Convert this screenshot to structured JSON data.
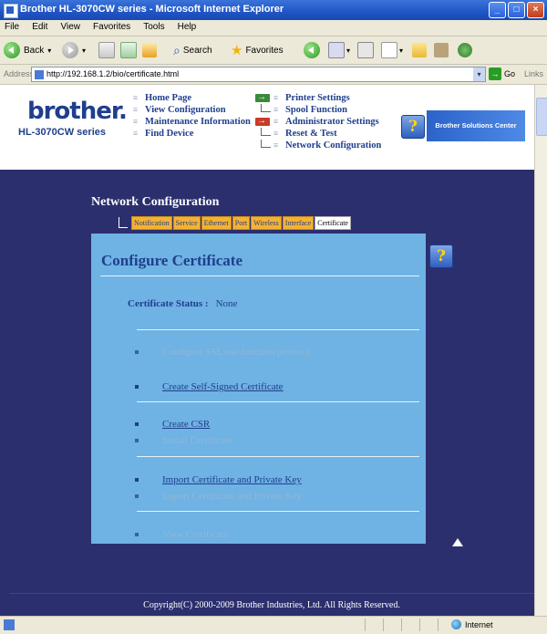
{
  "window": {
    "title": "Brother HL-3070CW series - Microsoft Internet Explorer",
    "buttons": [
      "_",
      "□",
      "×"
    ]
  },
  "menu": [
    "File",
    "Edit",
    "View",
    "Favorites",
    "Tools",
    "Help"
  ],
  "toolbar": {
    "back": "Back",
    "search": "Search",
    "favorites": "Favorites"
  },
  "address": {
    "label": "Address",
    "url": "http://192.168.1.2/bio/certificate.html",
    "go": "Go",
    "links": "Links"
  },
  "header": {
    "logo": "brother.",
    "model": "HL-3070CW series",
    "nav_left": [
      "Home Page",
      "View Configuration",
      "Maintenance Information",
      "Find Device"
    ],
    "nav_right": [
      "Printer Settings",
      "Spool Function",
      "Administrator Settings",
      "Reset & Test",
      "Network Configuration"
    ],
    "solutions": "Brother Solutions Center"
  },
  "section": {
    "title": "Network Configuration",
    "tabs": [
      "Notification",
      "Service",
      "Ethernet",
      "Port",
      "Wireless",
      "Interface",
      "Certificate"
    ],
    "active_tab": "Certificate"
  },
  "panel": {
    "title": "Configure Certificate",
    "status_label": "Certificate Status :",
    "status_value": "None",
    "items": [
      {
        "label": "Configure SSL use function/protocol",
        "enabled": false
      },
      {
        "label": "Create Self-Signed Certificate",
        "enabled": true
      },
      {
        "label": "Create CSR",
        "enabled": true
      },
      {
        "label": "Install Certificate",
        "enabled": false
      },
      {
        "label": "Import Certificate and Private Key",
        "enabled": true
      },
      {
        "label": "Export Certificate and Private Key",
        "enabled": false
      },
      {
        "label": "View Certificate",
        "enabled": false
      }
    ]
  },
  "footer": {
    "copyright": "Copyright(C) 2000-2009 Brother Industries, Ltd. All Rights Reserved."
  },
  "statusbar": {
    "zone": "Internet"
  },
  "colors": {
    "navy": "#2b2f6e",
    "panel": "#6fb2e4",
    "tab": "#f4b233",
    "link": "#1f3f8c"
  }
}
